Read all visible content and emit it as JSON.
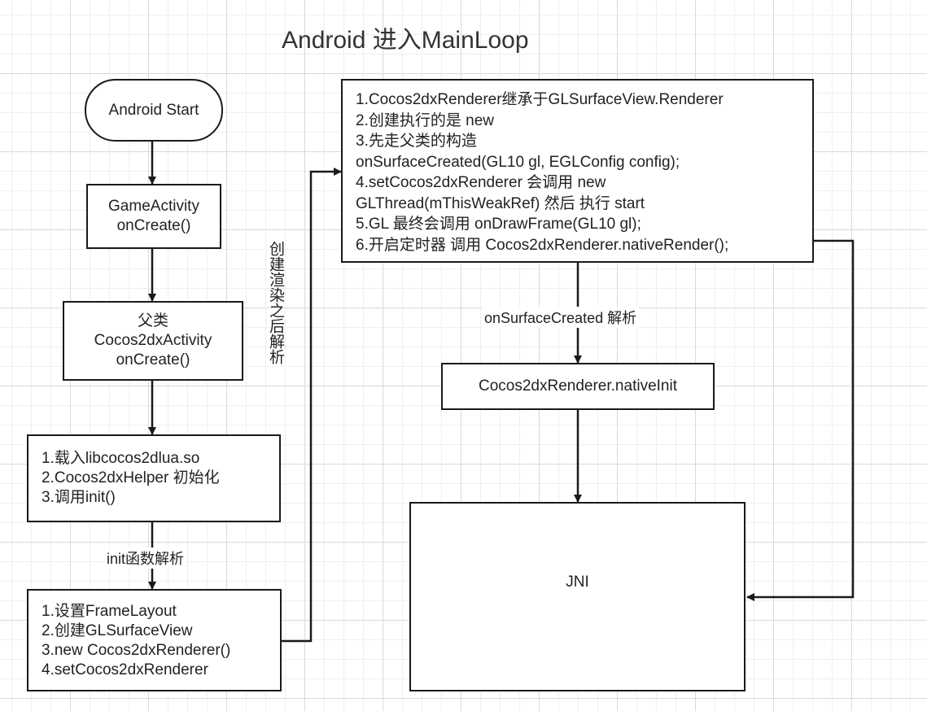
{
  "title": "Android 进入MainLoop",
  "nodes": {
    "start": {
      "label": "Android Start"
    },
    "game_activity": {
      "lines": [
        "GameActivity",
        "onCreate()"
      ]
    },
    "parent_activity": {
      "lines": [
        "父类",
        "Cocos2dxActivity",
        "onCreate()"
      ]
    },
    "init_steps": {
      "lines": [
        "1.载入libcocos2dlua.so",
        "2.Cocos2dxHelper 初始化",
        "3.调用init()"
      ]
    },
    "init_detail": {
      "lines": [
        "1.设置FrameLayout",
        "2.创建GLSurfaceView",
        "3.new Cocos2dxRenderer()",
        "4.setCocos2dxRenderer"
      ]
    },
    "renderer_info": {
      "lines": [
        "1.Cocos2dxRenderer继承于GLSurfaceView.Renderer",
        "2.创建执行的是 new",
        "3.先走父类的构造",
        "onSurfaceCreated(GL10 gl, EGLConfig config);",
        "4.setCocos2dxRenderer 会调用 new",
        "GLThread(mThisWeakRef) 然后 执行 start",
        "5.GL 最终会调用 onDrawFrame(GL10 gl);",
        "6.开启定时器 调用 Cocos2dxRenderer.nativeRender();"
      ]
    },
    "native_init": {
      "label": "Cocos2dxRenderer.nativeInit"
    },
    "jni": {
      "label": "JNI"
    }
  },
  "edge_labels": {
    "init_parse": "init函数解析",
    "after_render_parse": "创建渲染之后解析",
    "surface_created_parse": "onSurfaceCreated 解析"
  }
}
